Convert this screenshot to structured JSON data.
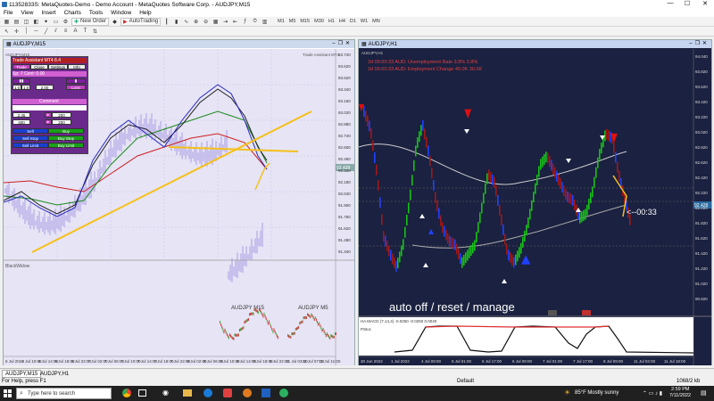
{
  "window": {
    "title": "11352833S: MetaQuotes-Demo - Demo Account - MetaQuotes Software Corp. - AUDJPY,M15",
    "min": "—",
    "max": "☐",
    "close": "✕"
  },
  "menu": [
    "File",
    "View",
    "Insert",
    "Charts",
    "Tools",
    "Window",
    "Help"
  ],
  "toolbar": {
    "new_order": "New Order",
    "autotrading": "AutoTrading",
    "timeframes": [
      "M1",
      "M5",
      "M15",
      "M30",
      "H1",
      "H4",
      "D1",
      "W1",
      "MN"
    ]
  },
  "left_chart": {
    "title": "AUDJPY,M15",
    "inner_title": "AUDJPY,M15",
    "assistant_label": "Trade Assistant MT4",
    "indicator_label": "BlackWidow",
    "mini_label_1": "AUDJPY M15",
    "mini_label_2": "AUDJPY M5",
    "price_label": "92.428",
    "xlabels": [
      "6 Jul 2022",
      "6 Jul 10:00",
      "6 Jul 14:00",
      "6 Jul 18:00",
      "6 Jul 22:00",
      "7 Jul 02:00",
      "7 Jul 06:00",
      "7 Jul 10:00",
      "7 Jul 14:00",
      "7 Jul 18:00",
      "7 Jul 22:00",
      "8 Jul 02:00",
      "8 Jul 06:00",
      "8 Jul 10:00",
      "8 Jul 14:00",
      "8 Jul 18:00",
      "8 Jul 22:00",
      "11 Jul 03:00",
      "11 Jul 07:00",
      "11 Jul 11:00"
    ],
    "ylabels": [
      "93.720",
      "93.620",
      "93.520",
      "93.340",
      "93.160",
      "93.020",
      "92.880",
      "92.740",
      "92.600",
      "92.460",
      "92.320",
      "92.180",
      "92.040",
      "91.900",
      "91.760",
      "91.620",
      "91.480",
      "91.340"
    ]
  },
  "trade_assistant": {
    "header": "Trade Assistant MT4 8.4",
    "tabs": [
      "Trade",
      "Close",
      "Settings",
      "Info"
    ],
    "sl_label": "Sp: 7  Cent: 0.00",
    "lot": "1.0",
    "risk": "2.00",
    "loss": "Loss",
    "comment_label": "Comment",
    "price": "2.45",
    "entry": "200",
    "sl_pts": "400",
    "tp_pts": "200",
    "buy": "Buy",
    "sell": "Sell",
    "buy_stop": "Buy Stop",
    "sell_stop": "Sell Stop",
    "buy_limit": "Buy Limit",
    "sell_limit": "Sell Limit"
  },
  "right_chart": {
    "title": "AUDJPY,H1",
    "inner_title": "AUDJPY,H1",
    "news_1": "2d 06:00:33  AUD: Unemployment Rate   3.8%   3.8%",
    "news_2": "2d 06:00:33  AUD: Employment Change   40.0K   30.0K",
    "countdown": "<--00:33",
    "caption": "auto off / reset / manage",
    "indicator_label": "HA MACD (7,14,4) -0.0250 -0.0250 0.0040",
    "sub_label": "PStoc",
    "price_label": "92.428",
    "xlabels": [
      "30 Jun 2022",
      "1 Jul 2022",
      "4 Jul 09:00",
      "5 Jul 01:00",
      "5 Jul 17:00",
      "6 Jul 09:00",
      "7 Jul 01:00",
      "7 Jul 17:00",
      "8 Jul 09:00",
      "11 Jul 02:00",
      "11 Jul 18:00"
    ],
    "ylabels": [
      "94.040",
      "93.820",
      "93.620",
      "93.420",
      "93.220",
      "93.020",
      "92.820",
      "92.620",
      "92.420",
      "92.220",
      "92.020",
      "91.820",
      "91.620",
      "91.420",
      "91.220",
      "91.020",
      "90.820"
    ]
  },
  "tabs": [
    "AUDJPY,M15",
    "AUDJPY,H1"
  ],
  "status": {
    "help": "For Help, press F1",
    "profile": "Default",
    "traffic": "1068/2 kb"
  },
  "taskbar": {
    "search": "Type here to search",
    "weather": "85°F  Mostly sunny",
    "time": "2:59 PM",
    "date": "7/11/2022"
  }
}
